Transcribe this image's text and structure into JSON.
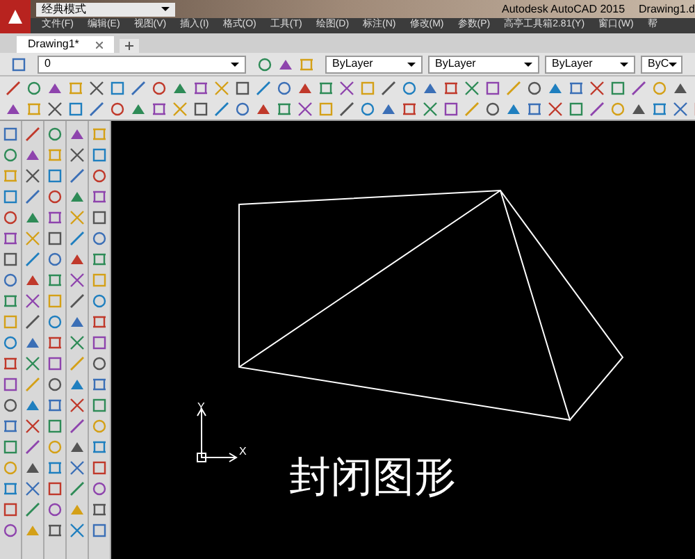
{
  "title_bar": {
    "workspace": "经典模式",
    "app_title": "Autodesk AutoCAD 2015",
    "document_title": "Drawing1.d"
  },
  "menu": [
    "文件(F)",
    "编辑(E)",
    "视图(V)",
    "插入(I)",
    "格式(O)",
    "工具(T)",
    "绘图(D)",
    "标注(N)",
    "修改(M)",
    "参数(P)",
    "高亭工具箱2.81(Y)",
    "窗口(W)",
    "帮"
  ],
  "tabs": [
    {
      "label": "Drawing1*",
      "selected": true
    }
  ],
  "layer_toolbar": {
    "layer": "0",
    "color_setting": "ByLayer",
    "linetype": "ByLayer",
    "lineweight": "ByLayer",
    "plot_style": "ByC"
  },
  "canvas": {
    "caption": "封闭图形",
    "ucs": {
      "x_label": "X",
      "y_label": "Y"
    }
  }
}
